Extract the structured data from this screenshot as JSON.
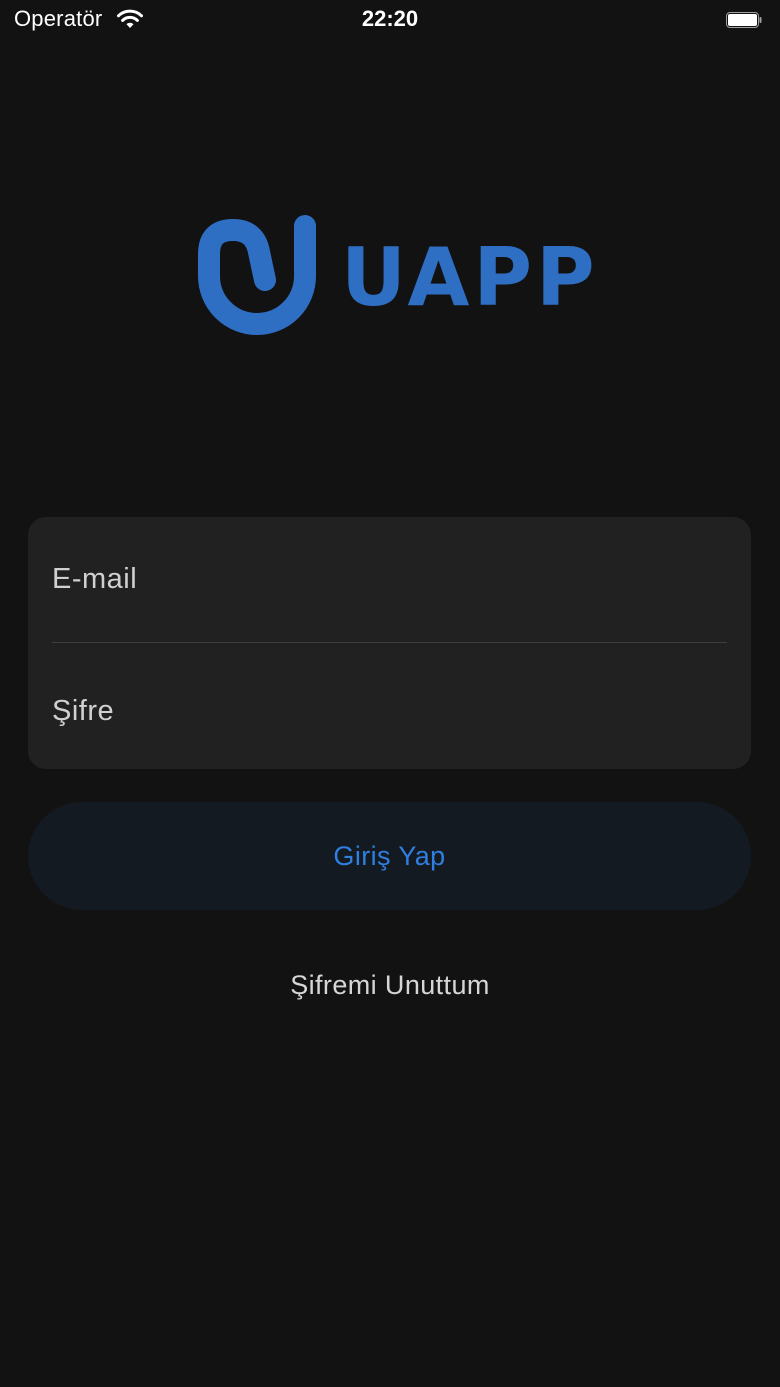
{
  "status_bar": {
    "carrier": "Operatör",
    "time": "22:20",
    "wifi_icon": "wifi-icon",
    "battery_icon": "battery-icon"
  },
  "logo": {
    "mark_icon": "uapp-logo-mark",
    "wordmark": "UAPP",
    "brand_color": "#2e6fc4"
  },
  "form": {
    "email_placeholder": "E-mail",
    "email_value": "",
    "password_placeholder": "Şifre",
    "password_value": ""
  },
  "actions": {
    "login_label": "Giriş Yap",
    "forgot_password_label": "Şifremi Unuttum",
    "accent_color": "#2f7fe0"
  }
}
